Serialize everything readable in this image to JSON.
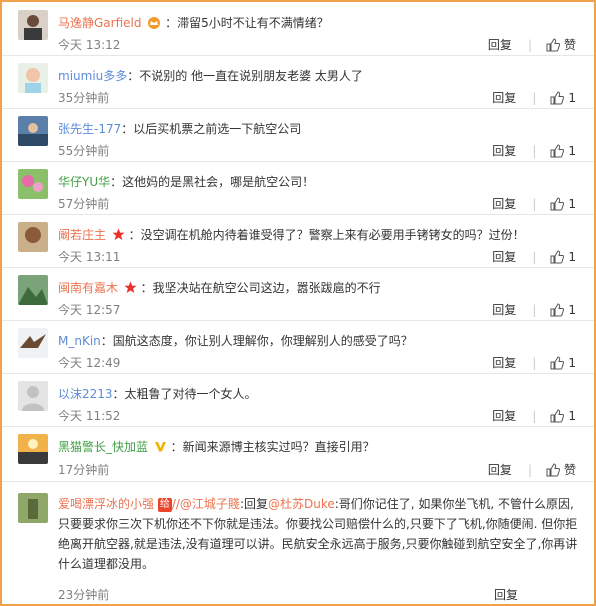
{
  "comments": [
    {
      "name": "马逸静Garfield",
      "text": "：滞留5小时不让有不满情绪？",
      "time": "今天 13:12",
      "reply": "回复",
      "like": "赞"
    },
    {
      "name": "miumiu多多",
      "text": "：不说别的 他一直在说别朋友老婆 太男人了",
      "time": "35分钟前",
      "reply": "回复",
      "like": "1"
    },
    {
      "name": "张先生-177",
      "text": "：以后买机票之前选一下航空公司",
      "time": "55分钟前",
      "reply": "回复",
      "like": "1"
    },
    {
      "name": "华仔YU华",
      "text": "：这他妈的是黑社会，哪是航空公司！",
      "time": "57分钟前",
      "reply": "回复",
      "like": "1"
    },
    {
      "name": "阚若庄主",
      "text": "：没空调在机舱内待着谁受得了？警察上来有必要用手铐铐女的吗？过份！",
      "time": "今天 13:11",
      "reply": "回复",
      "like": "1"
    },
    {
      "name": "闽南有嘉木",
      "text": "：我坚决站在航空公司这边，嚣张跋扈的不行",
      "time": "今天 12:57",
      "reply": "回复",
      "like": "1"
    },
    {
      "name": "M_nKin",
      "text": "：国航这态度，你让别人理解你，你理解别人的感受了吗？",
      "time": "今天 12:49",
      "reply": "回复",
      "like": "1"
    },
    {
      "name": "以沫2213",
      "text": "：太粗鲁了对待一个女人。",
      "time": "今天 11:52",
      "reply": "回复",
      "like": "1"
    },
    {
      "name": "黑猫警长_快加蓝",
      "text": "：新闻来源博主核实过吗？直接引用？",
      "time": "17分钟前",
      "reply": "回复",
      "like": "赞"
    }
  ],
  "last": {
    "name": "爱喝漂浮冰的小强",
    "badge": "给",
    "mention1": "//@江城子賤",
    "mid": ":回复",
    "mention2": "@杜苏Duke",
    "text": ":哥们你记住了, 如果你坐飞机, 不管什么原因, 只要要求你三次下机你还不下你就是违法。你要找公司赔偿什么的,只要下了飞机,你随便闹. 但你拒绝离开航空器,就是违法,没有道理可以讲。民航安全永远高于服务,只要你触碰到航空安全了,你再讲什么道理都没用。",
    "time": "23分钟前",
    "reply": "回复"
  },
  "icons": {
    "vip": "crown-badge-icon",
    "star": "red-star-icon",
    "verified": "yellow-v-icon",
    "like": "thumbs-up-icon"
  },
  "colors": {
    "name": "#eb7350",
    "frame": "#f0a24a"
  }
}
